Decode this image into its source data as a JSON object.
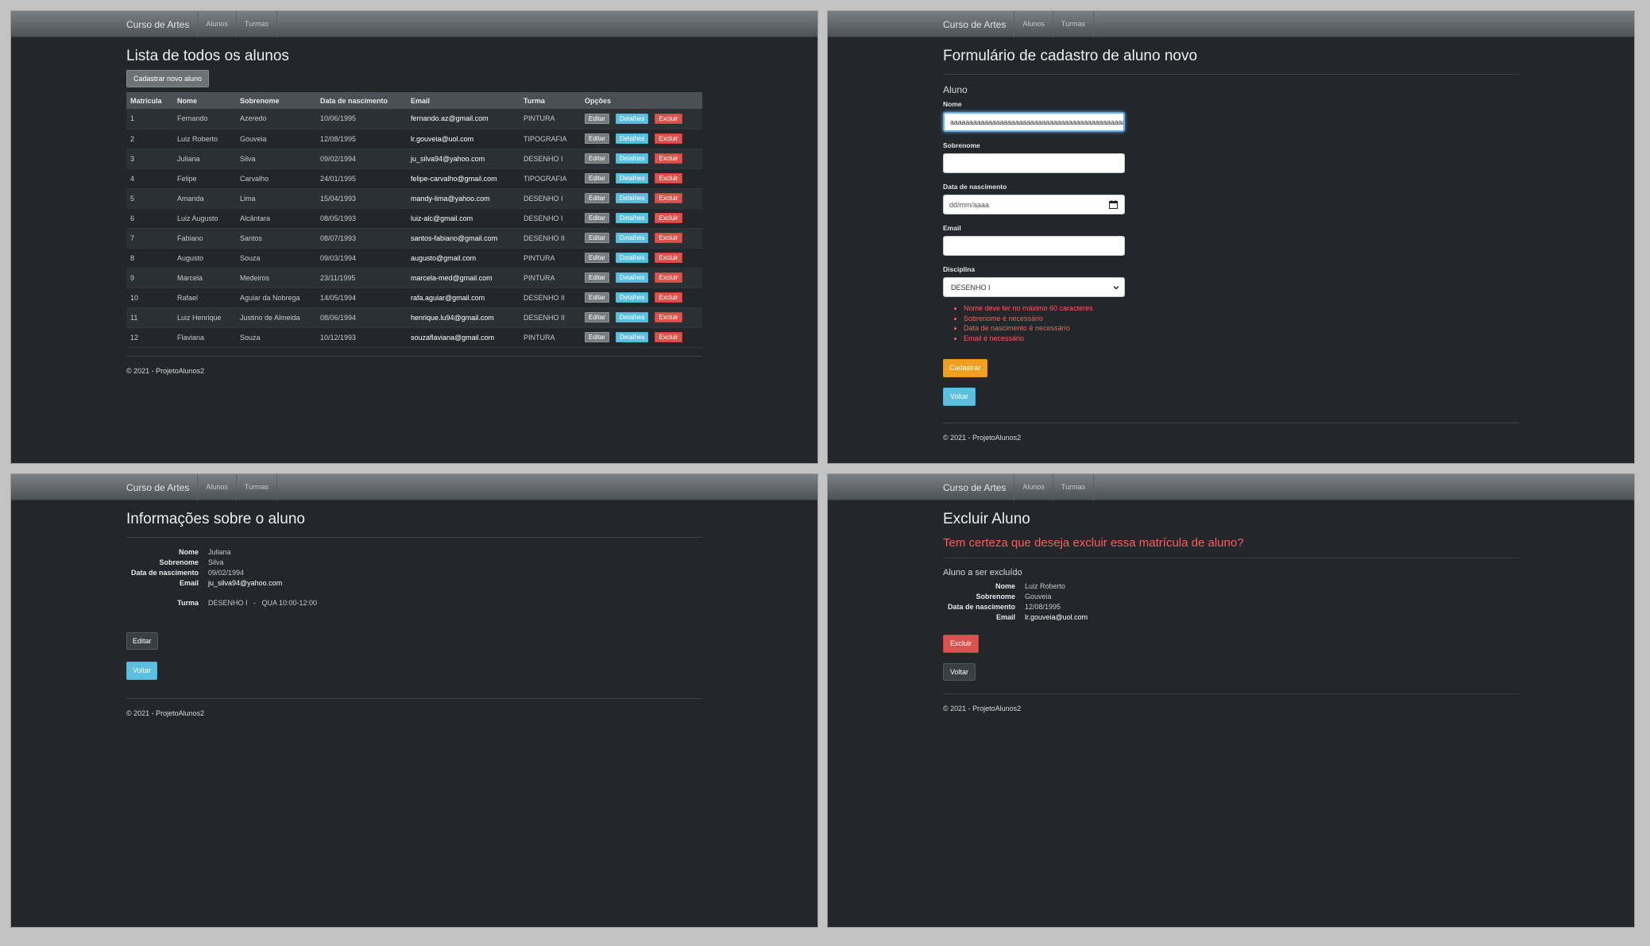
{
  "nav": {
    "brand": "Curso de Artes",
    "alunos": "Alunos",
    "turmas": "Turmas"
  },
  "footer": "© 2021 - ProjetoAlunos2",
  "list": {
    "title": "Lista de todos os alunos",
    "new_button": "Cadastrar novo aluno",
    "columns": [
      "Matrícula",
      "Nome",
      "Sobrenome",
      "Data de nascimento",
      "Email",
      "Turma",
      "Opções"
    ],
    "actions": {
      "edit": "Editar",
      "details": "Detalhes",
      "delete": "Excluir"
    },
    "rows": [
      [
        "1",
        "Fernando",
        "Azeredo",
        "10/06/1995",
        "fernando.az@gmail.com",
        "PINTURA"
      ],
      [
        "2",
        "Luiz Roberto",
        "Gouveia",
        "12/08/1995",
        "lr.gouveia@uol.com",
        "TIPOGRAFIA"
      ],
      [
        "3",
        "Juliana",
        "Silva",
        "09/02/1994",
        "ju_silva94@yahoo.com",
        "DESENHO I"
      ],
      [
        "4",
        "Felipe",
        "Carvalho",
        "24/01/1995",
        "felipe-carvalho@gmail.com",
        "TIPOGRAFIA"
      ],
      [
        "5",
        "Amanda",
        "Lima",
        "15/04/1993",
        "mandy-lima@yahoo.com",
        "DESENHO I"
      ],
      [
        "6",
        "Luiz Augusto",
        "Alcântara",
        "08/05/1993",
        "luiz-alc@gmail.com",
        "DESENHO I"
      ],
      [
        "7",
        "Fabiano",
        "Santos",
        "08/07/1993",
        "santos-fabiano@gmail.com",
        "DESENHO II"
      ],
      [
        "8",
        "Augusto",
        "Souza",
        "09/03/1994",
        "augusto@gmail.com",
        "PINTURA"
      ],
      [
        "9",
        "Marcela",
        "Medeiros",
        "23/11/1995",
        "marcela-med@gmail.com",
        "PINTURA"
      ],
      [
        "10",
        "Rafael",
        "Aguiar da Nobrega",
        "14/05/1994",
        "rafa.aguiar@gmail.com",
        "DESENHO II"
      ],
      [
        "11",
        "Luiz Henrique",
        "Justino de Almeida",
        "08/06/1994",
        "henrique.lu94@gmail.com",
        "DESENHO II"
      ],
      [
        "12",
        "Flaviana",
        "Souza",
        "10/12/1993",
        "souzaflaviana@gmail.com",
        "PINTURA"
      ]
    ]
  },
  "form": {
    "title": "Formulário de cadastro de aluno novo",
    "section": "Aluno",
    "nome_label": "Nome",
    "nome_value": "aaaaaaaaaaaaaaaaaaaaaaaaaaaaaaaaaaaaaaaaaaaaaaaaaaaaaaaaaaaaaaaaaaa",
    "sobrenome_label": "Sobrenome",
    "nascimento_label": "Data de nascimento",
    "nascimento_placeholder": "dd/mm/aaaa",
    "email_label": "Email",
    "disciplina_label": "Disciplina",
    "disciplina_value": "DESENHO I",
    "errors": [
      "Nome deve ter no máximo 60 caracteres",
      "Sobrenome é necessário",
      "Data de nascimento é necessário",
      "Email é necessário"
    ],
    "submit": "Cadastrar",
    "back": "Voltar"
  },
  "details": {
    "title": "Informações sobre o aluno",
    "labels": {
      "nome": "Nome",
      "sobrenome": "Sobrenome",
      "nascimento": "Data de nascimento",
      "email": "Email",
      "turma": "Turma"
    },
    "values": {
      "nome": "Juliana",
      "sobrenome": "Silva",
      "nascimento": "09/02/1994",
      "email": "ju_silva94@yahoo.com",
      "turma": "DESENHO I   -   QUA 10:00-12:00"
    },
    "edit": "Editar",
    "back": "Voltar"
  },
  "delete": {
    "title": "Excluir Aluno",
    "question": "Tem certeza que deseja excluir essa matrícula de aluno?",
    "subtitle": "Aluno a ser excluído",
    "labels": {
      "nome": "Nome",
      "sobrenome": "Sobrenome",
      "nascimento": "Data de nascimento",
      "email": "Email"
    },
    "values": {
      "nome": "Luiz Roberto",
      "sobrenome": "Gouveia",
      "nascimento": "12/08/1995",
      "email": "lr.gouveia@uol.com"
    },
    "delete_button": "Excluir",
    "back": "Voltar"
  }
}
